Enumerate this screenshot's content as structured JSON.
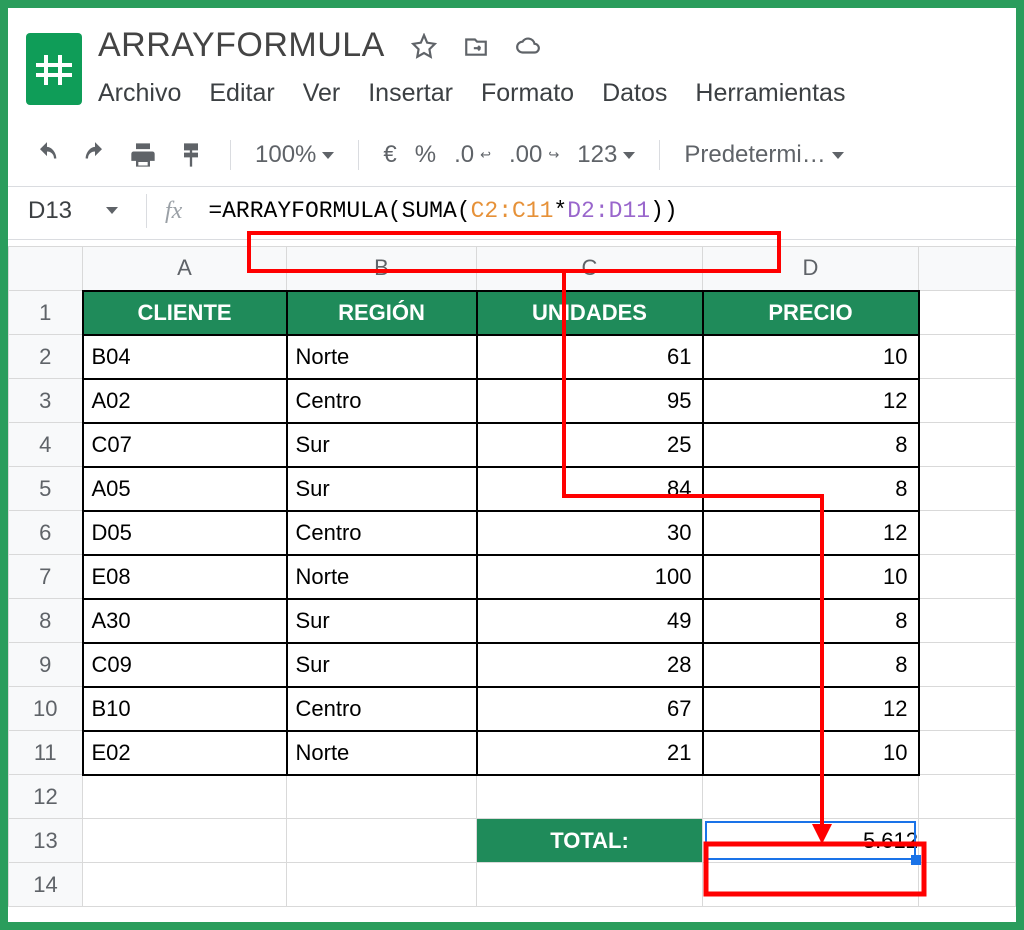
{
  "doc_title": "ARRAYFORMULA",
  "menus": [
    "Archivo",
    "Editar",
    "Ver",
    "Insertar",
    "Formato",
    "Datos",
    "Herramientas"
  ],
  "toolbar": {
    "zoom": "100%",
    "currency": "€",
    "percent": "%",
    "dec_less": ".0",
    "dec_more": ".00",
    "numfmt": "123",
    "font": "Predetermi…"
  },
  "name_box": "D13",
  "formula": {
    "prefix": "=ARRAYFORMULA(",
    "suma": "SUMA",
    "paren_open": "(",
    "range1": "C2:C11",
    "star": "*",
    "range2": "D2:D11",
    "paren_close": ")",
    "suffix": ")"
  },
  "columns": [
    "A",
    "B",
    "C",
    "D"
  ],
  "selected_col": "D",
  "headers": [
    "CLIENTE",
    "REGIÓN",
    "UNIDADES",
    "PRECIO"
  ],
  "rows": [
    {
      "n": "2",
      "cliente": "B04",
      "region": "Norte",
      "unidades": "61",
      "precio": "10"
    },
    {
      "n": "3",
      "cliente": "A02",
      "region": "Centro",
      "unidades": "95",
      "precio": "12"
    },
    {
      "n": "4",
      "cliente": "C07",
      "region": "Sur",
      "unidades": "25",
      "precio": "8"
    },
    {
      "n": "5",
      "cliente": "A05",
      "region": "Sur",
      "unidades": "84",
      "precio": "8"
    },
    {
      "n": "6",
      "cliente": "D05",
      "region": "Centro",
      "unidades": "30",
      "precio": "12"
    },
    {
      "n": "7",
      "cliente": "E08",
      "region": "Norte",
      "unidades": "100",
      "precio": "10"
    },
    {
      "n": "8",
      "cliente": "A30",
      "region": "Sur",
      "unidades": "49",
      "precio": "8"
    },
    {
      "n": "9",
      "cliente": "C09",
      "region": "Sur",
      "unidades": "28",
      "precio": "8"
    },
    {
      "n": "10",
      "cliente": "B10",
      "region": "Centro",
      "unidades": "67",
      "precio": "12"
    },
    {
      "n": "11",
      "cliente": "E02",
      "region": "Norte",
      "unidades": "21",
      "precio": "10"
    }
  ],
  "row12": "12",
  "row13": "13",
  "row14": "14",
  "total_label": "TOTAL:",
  "total_value": "5.612"
}
